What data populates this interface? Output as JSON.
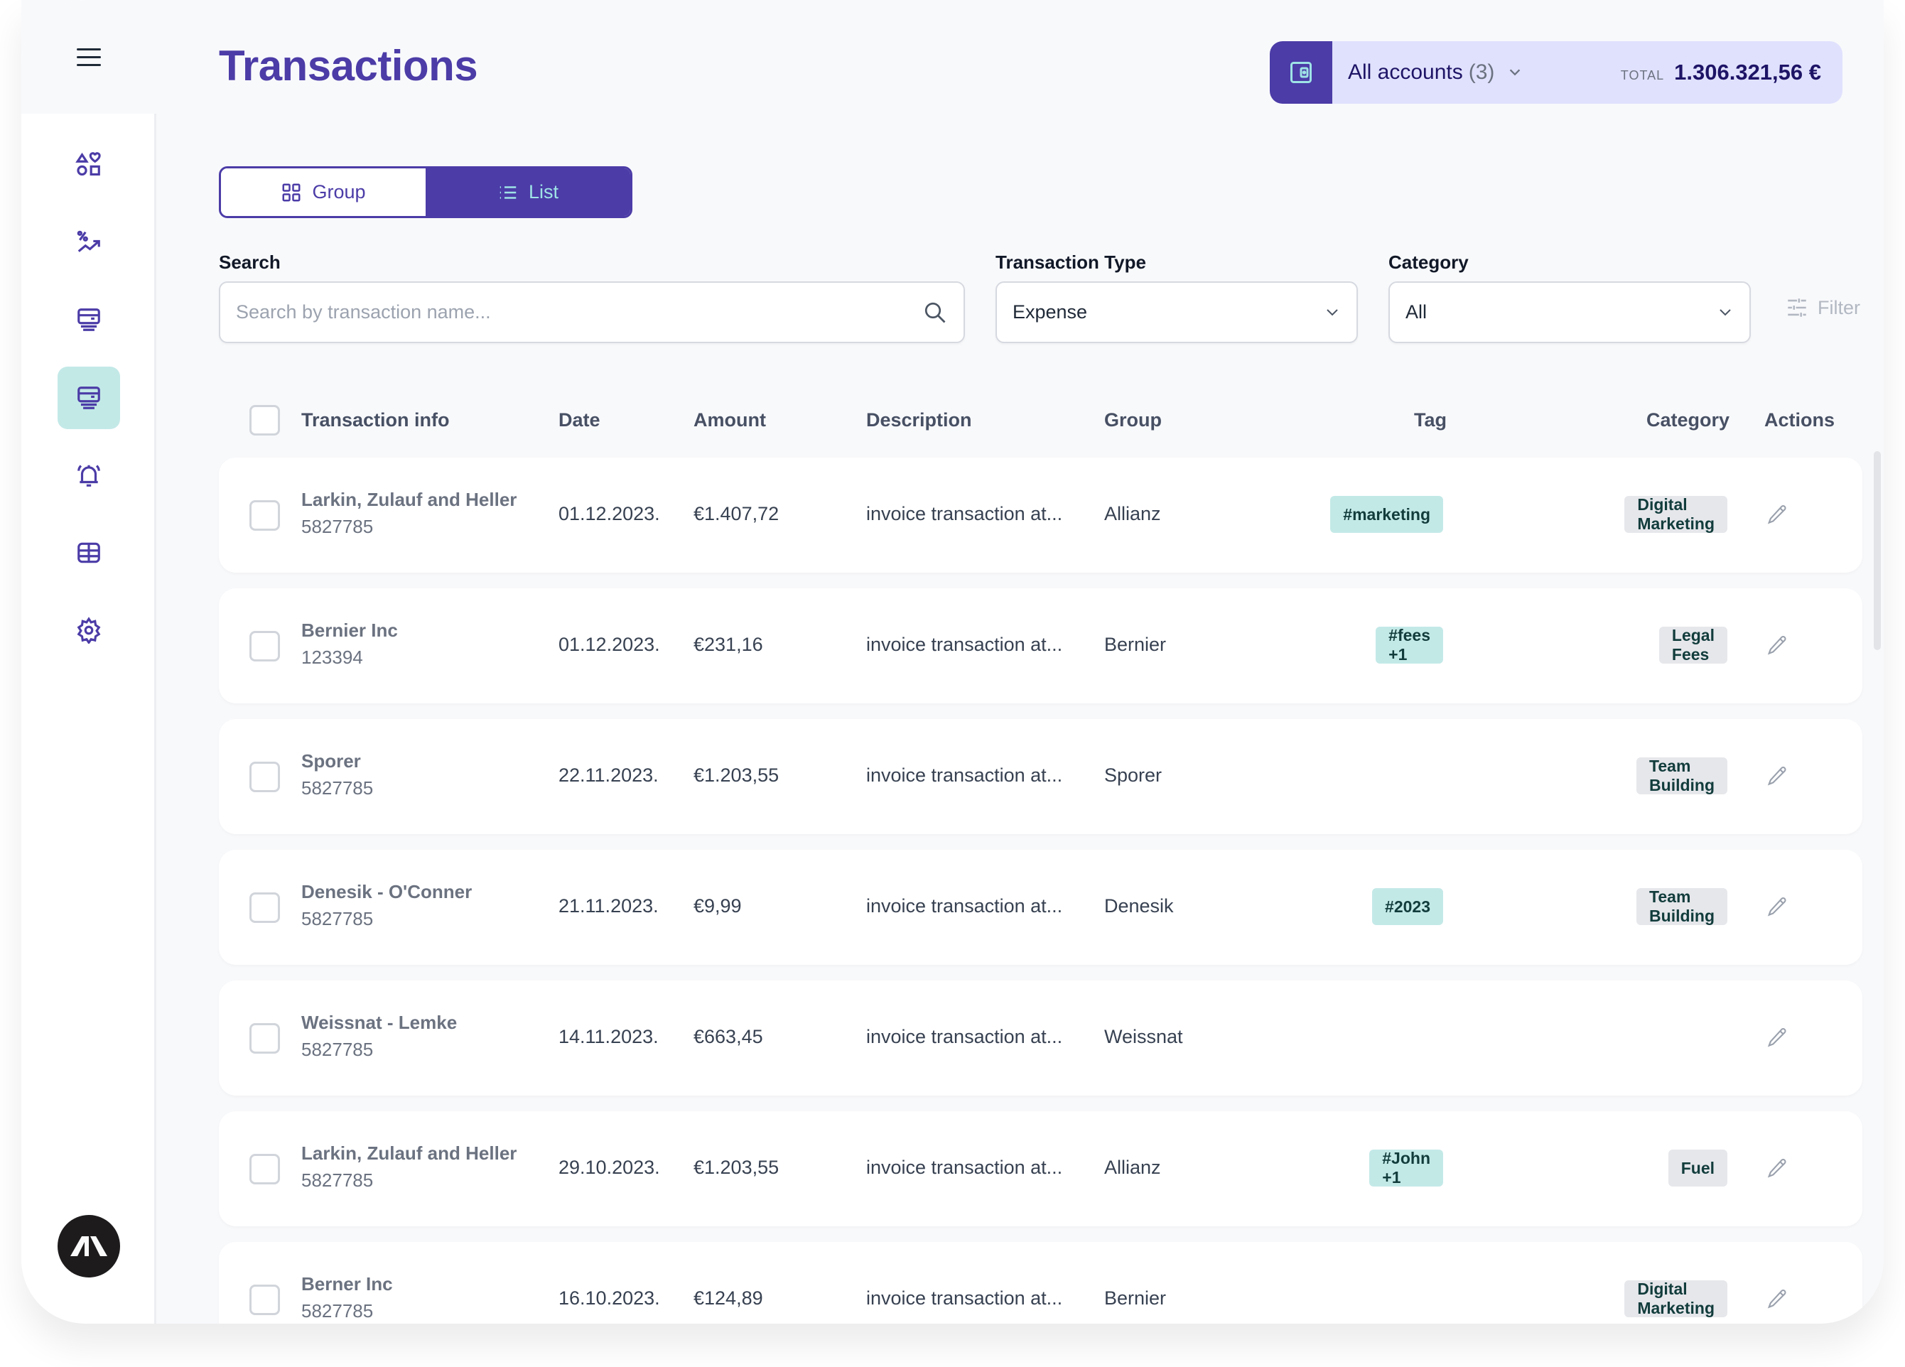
{
  "sidebar": {
    "menu_icon": "hamburger-menu-icon",
    "items": [
      {
        "name": "dashboard",
        "icon": "shapes-icon",
        "active": false
      },
      {
        "name": "investments",
        "icon": "percent-trend-icon",
        "active": false
      },
      {
        "name": "accounts",
        "icon": "card-stack-icon",
        "active": false
      },
      {
        "name": "transactions",
        "icon": "card-stack-icon",
        "active": true
      },
      {
        "name": "alerts",
        "icon": "alarm-bell-icon",
        "active": false
      },
      {
        "name": "reports",
        "icon": "table-icon",
        "active": false
      },
      {
        "name": "settings",
        "icon": "gear-icon",
        "active": false
      }
    ],
    "avatar_icon": "brand-logo-icon"
  },
  "header": {
    "title": "Transactions",
    "account_selector": {
      "label": "All accounts",
      "count": "(3)",
      "total_label": "TOTAL",
      "total_value": "1.306.321,56 €"
    }
  },
  "view_toggle": {
    "group_label": "Group",
    "list_label": "List",
    "active": "List"
  },
  "filters": {
    "search_label": "Search",
    "search_placeholder": "Search by transaction name...",
    "search_value": "",
    "type_label": "Transaction Type",
    "type_value": "Expense",
    "category_label": "Category",
    "category_value": "All",
    "filter_button": "Filter"
  },
  "table": {
    "columns": {
      "info": "Transaction info",
      "date": "Date",
      "amount": "Amount",
      "description": "Description",
      "group": "Group",
      "tag": "Tag",
      "category": "Category",
      "actions": "Actions"
    },
    "rows": [
      {
        "name": "Larkin, Zulauf and Heller",
        "code": "5827785",
        "date": "01.12.2023.",
        "amount": "€1.407,72",
        "description": "invoice transaction at...",
        "group": "Allianz",
        "tag": "#marketing",
        "category": "Digital Marketing"
      },
      {
        "name": "Bernier Inc",
        "code": "123394",
        "date": "01.12.2023.",
        "amount": "€231,16",
        "description": "invoice transaction at...",
        "group": "Bernier",
        "tag": "#fees +1",
        "category": "Legal Fees"
      },
      {
        "name": "Sporer",
        "code": "5827785",
        "date": "22.11.2023.",
        "amount": "€1.203,55",
        "description": "invoice transaction at...",
        "group": "Sporer",
        "tag": "",
        "category": "Team Building"
      },
      {
        "name": "Denesik - O'Conner",
        "code": "5827785",
        "date": "21.11.2023.",
        "amount": "€9,99",
        "description": "invoice transaction at...",
        "group": "Denesik",
        "tag": "#2023",
        "category": "Team Building"
      },
      {
        "name": "Weissnat - Lemke",
        "code": "5827785",
        "date": "14.11.2023.",
        "amount": "€663,45",
        "description": "invoice transaction at...",
        "group": "Weissnat",
        "tag": "",
        "category": ""
      },
      {
        "name": "Larkin, Zulauf and Heller",
        "code": "5827785",
        "date": "29.10.2023.",
        "amount": "€1.203,55",
        "description": "invoice transaction at...",
        "group": "Allianz",
        "tag": "#John +1",
        "category": "Fuel"
      },
      {
        "name": "Berner Inc",
        "code": "5827785",
        "date": "16.10.2023.",
        "amount": "€124,89",
        "description": "invoice transaction at...",
        "group": "Bernier",
        "tag": "",
        "category": "Digital Marketing"
      }
    ]
  },
  "colors": {
    "primary": "#4b3ca7",
    "accent_teal": "#c3e9e7",
    "account_bg": "#e0e1fd",
    "category_bg": "#e6e7eb"
  }
}
